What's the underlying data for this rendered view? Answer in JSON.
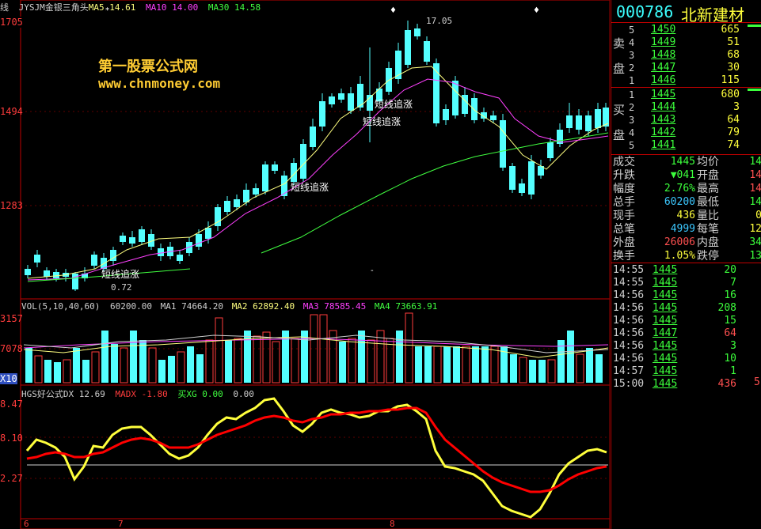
{
  "main_header": {
    "corner": "线",
    "formula": "JYSJM金银三角头",
    "ma5": "MA5  14.61",
    "ma10": "MA10  14.00",
    "ma30": "MA30  14.58"
  },
  "watermark": {
    "line1": "第一股票公式网",
    "line2": "www.chnmoney.com"
  },
  "price_axis": [
    "1705",
    "1494",
    "1283"
  ],
  "annotations": {
    "high": "17.05",
    "low": "0.72",
    "signals": [
      "短线追涨",
      "短线追涨",
      "短线追涨",
      "短线追涨"
    ]
  },
  "volume_header": {
    "vol": "VOL(5,10,40,60)",
    "vol_val": "60200.00",
    "ma1": "MA1  74664.20",
    "ma2": "MA2  62892.40",
    "ma3": "MA3  78585.45",
    "ma4": "MA4  73663.91"
  },
  "volume_axis": [
    "3157",
    "7078",
    "X10"
  ],
  "indicator_header": {
    "name": "HGS好公式DX  12.69",
    "madx": "MADX  -1.80",
    "buy": "买XG  0.00",
    "last": "0.00"
  },
  "indicator_axis": [
    "8.47",
    "8.10",
    "2.27"
  ],
  "date_axis": [
    "6",
    "7",
    "8"
  ],
  "quote": {
    "code": "000786",
    "name": "北新建材",
    "sell_label": [
      "卖",
      "盘"
    ],
    "buy_label": [
      "买",
      "盘"
    ],
    "sell": [
      {
        "level": "5",
        "price": "1450",
        "vol": "665"
      },
      {
        "level": "4",
        "price": "1449",
        "vol": "51"
      },
      {
        "level": "3",
        "price": "1448",
        "vol": "68"
      },
      {
        "level": "2",
        "price": "1447",
        "vol": "30"
      },
      {
        "level": "1",
        "price": "1446",
        "vol": "115"
      }
    ],
    "buy": [
      {
        "level": "1",
        "price": "1445",
        "vol": "680"
      },
      {
        "level": "2",
        "price": "1444",
        "vol": "3"
      },
      {
        "level": "3",
        "price": "1443",
        "vol": "64"
      },
      {
        "level": "4",
        "price": "1442",
        "vol": "79"
      },
      {
        "level": "5",
        "price": "1441",
        "vol": "74"
      }
    ],
    "stats": [
      {
        "l1": "成交",
        "v1": "1445",
        "l2": "均价",
        "v2": "14",
        "c1": "#3cff3c",
        "c2": "#3cff3c"
      },
      {
        "l1": "升跌",
        "v1": "▼041",
        "l2": "开盘",
        "v2": "14",
        "c1": "#3cff3c",
        "c2": "#ff5050"
      },
      {
        "l1": "幅度",
        "v1": "2.76%",
        "l2": "最高",
        "v2": "14",
        "c1": "#3cff3c",
        "c2": "#ff5050"
      },
      {
        "l1": "总手",
        "v1": "60200",
        "l2": "最低",
        "v2": "14",
        "c1": "#3cc8ff",
        "c2": "#3cff3c"
      },
      {
        "l1": "现手",
        "v1": "436",
        "l2": "量比",
        "v2": "0",
        "c1": "#ffff3c",
        "c2": "#ffff3c"
      },
      {
        "l1": "总笔",
        "v1": "4999",
        "l2": "每笔",
        "v2": "12",
        "c1": "#3cc8ff",
        "c2": "#ffff3c"
      },
      {
        "l1": "外盘",
        "v1": "26006",
        "l2": "内盘",
        "v2": "34",
        "c1": "#ff5050",
        "c2": "#3cff3c"
      },
      {
        "l1": "换手",
        "v1": "1.05%",
        "l2": "跌停",
        "v2": "13",
        "c1": "#ffff3c",
        "c2": "#3cff3c"
      }
    ],
    "ticks": [
      {
        "time": "14:55",
        "price": "1445",
        "vol": "20",
        "c": "#3cff3c"
      },
      {
        "time": "14:55",
        "price": "1445",
        "vol": "7",
        "c": "#3cff3c"
      },
      {
        "time": "14:56",
        "price": "1445",
        "vol": "16",
        "c": "#3cff3c"
      },
      {
        "time": "14:56",
        "price": "1445",
        "vol": "208",
        "c": "#3cff3c"
      },
      {
        "time": "14:56",
        "price": "1445",
        "vol": "15",
        "c": "#3cff3c"
      },
      {
        "time": "14:56",
        "price": "1447",
        "vol": "64",
        "c": "#ff5050"
      },
      {
        "time": "14:56",
        "price": "1445",
        "vol": "3",
        "c": "#3cff3c"
      },
      {
        "time": "14:56",
        "price": "1445",
        "vol": "10",
        "c": "#3cff3c"
      },
      {
        "time": "14:57",
        "price": "1445",
        "vol": "1",
        "c": "#3cff3c"
      },
      {
        "time": "15:00",
        "price": "1445",
        "vol": "436",
        "c": "#ff5050"
      }
    ],
    "tick_extra": "5"
  },
  "colors": {
    "up": "#ff3c3c",
    "down": "#54ffff",
    "ma5": "#ffff80",
    "ma10": "#ff40ff",
    "ma30": "#40ff40",
    "border": "#c00000"
  }
}
